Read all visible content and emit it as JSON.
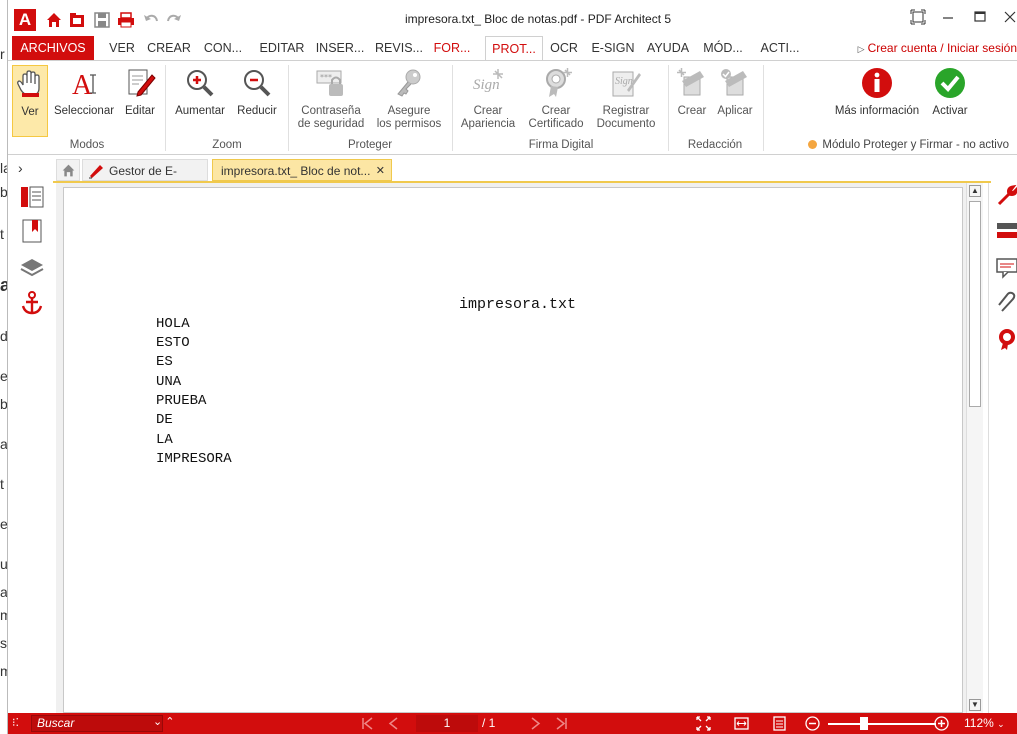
{
  "window": {
    "title": "impresora.txt_ Bloc de notas.pdf   -   PDF Architect 5",
    "logo_letter": "A"
  },
  "menu_tabs": [
    {
      "label": "ARCHIVOS"
    },
    {
      "label": "VER"
    },
    {
      "label": "CREAR"
    },
    {
      "label": "CON..."
    },
    {
      "label": "EDITAR"
    },
    {
      "label": "INSER..."
    },
    {
      "label": "REVIS..."
    },
    {
      "label": "FOR..."
    },
    {
      "label": "PROT..."
    },
    {
      "label": "OCR"
    },
    {
      "label": "E-SIGN"
    },
    {
      "label": "AYUDA"
    },
    {
      "label": "MÓD..."
    },
    {
      "label": "ACTI..."
    }
  ],
  "account_link": "Crear cuenta / Iniciar sesión",
  "ribbon": {
    "modos": {
      "group": "Modos",
      "ver": "Ver",
      "seleccionar": "Seleccionar",
      "editar": "Editar"
    },
    "zoom": {
      "group": "Zoom",
      "aumentar": "Aumentar",
      "reducir": "Reducir"
    },
    "proteger": {
      "group": "Proteger",
      "contrasena_1": "Contraseña",
      "contrasena_2": "de seguridad",
      "asegure_1": "Asegure",
      "asegure_2": "los permisos"
    },
    "firma": {
      "group": "Firma Digital",
      "apariencia_1": "Crear",
      "apariencia_2": "Apariencia",
      "certificado_1": "Crear",
      "certificado_2": "Certificado",
      "registrar_1": "Registrar",
      "registrar_2": "Documento"
    },
    "redaccion": {
      "group": "Redacción",
      "crear": "Crear",
      "aplicar": "Aplicar"
    },
    "mas_info": "Más información",
    "activar": "Activar",
    "modulo_status": "Módulo Proteger y Firmar - no activo"
  },
  "doc_tabs": {
    "esign": "Gestor de E-Sign",
    "active": "impresora.txt_ Bloc de not...",
    "close": "✕"
  },
  "document": {
    "title": "impresora.txt",
    "lines": [
      "HOLA",
      "ESTO",
      "ES",
      "UNA",
      "PRUEBA",
      "DE",
      "LA",
      "IMPRESORA"
    ]
  },
  "statusbar": {
    "search_placeholder": "Buscar",
    "page": "1",
    "total": "/ 1",
    "zoom": "112%",
    "zoom_fraction": 0.33
  },
  "bg_letters": [
    "r",
    "la",
    "b",
    "t",
    "a",
    "d",
    "e",
    "b",
    "a",
    "t",
    "e",
    "u",
    "ar",
    "m",
    "s",
    "m"
  ],
  "colors": {
    "accent": "#d20d0d",
    "highlight": "#fde9a9",
    "success": "#2aa52a"
  }
}
